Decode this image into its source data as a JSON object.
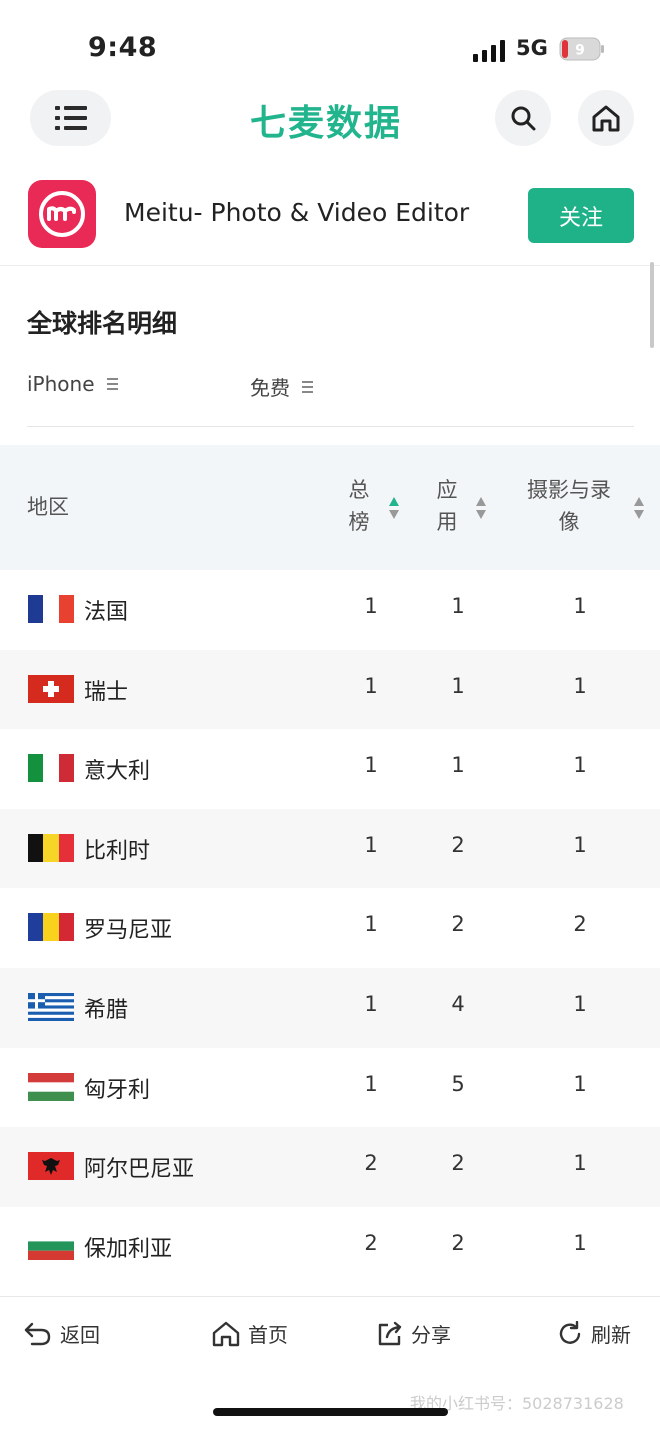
{
  "status": {
    "time": "9:48",
    "network": "5G",
    "battery": "9"
  },
  "nav": {
    "logo": "七麦数据"
  },
  "app": {
    "name": "Meitu- Photo & Video Editor",
    "follow_label": "关注"
  },
  "section": {
    "title": "全球排名明细"
  },
  "filters": {
    "device": "iPhone",
    "price": "免费"
  },
  "table": {
    "headers": {
      "region": "地区",
      "overall_line1": "总",
      "overall_line2": "榜",
      "app_line1": "应",
      "app_line2": "用",
      "category_line1": "摄影与录",
      "category_line2": "像"
    },
    "rows": [
      {
        "flag": "france",
        "country": "法国",
        "overall": "1",
        "app": "1",
        "category": "1"
      },
      {
        "flag": "switzerland",
        "country": "瑞士",
        "overall": "1",
        "app": "1",
        "category": "1"
      },
      {
        "flag": "italy",
        "country": "意大利",
        "overall": "1",
        "app": "1",
        "category": "1"
      },
      {
        "flag": "belgium",
        "country": "比利时",
        "overall": "1",
        "app": "2",
        "category": "1"
      },
      {
        "flag": "romania",
        "country": "罗马尼亚",
        "overall": "1",
        "app": "2",
        "category": "2"
      },
      {
        "flag": "greece",
        "country": "希腊",
        "overall": "1",
        "app": "4",
        "category": "1"
      },
      {
        "flag": "hungary",
        "country": "匈牙利",
        "overall": "1",
        "app": "5",
        "category": "1"
      },
      {
        "flag": "albania",
        "country": "阿尔巴尼亚",
        "overall": "2",
        "app": "2",
        "category": "1"
      },
      {
        "flag": "bulgaria",
        "country": "保加利亚",
        "overall": "2",
        "app": "2",
        "category": "1"
      }
    ]
  },
  "bottom_bar": {
    "back": "返回",
    "home": "首页",
    "share": "分享",
    "refresh": "刷新"
  },
  "watermark": "我的小红书号：5028731628",
  "colors": {
    "brand": "#22b58d",
    "button": "#1fb289",
    "app_icon": "#ea2a56"
  }
}
